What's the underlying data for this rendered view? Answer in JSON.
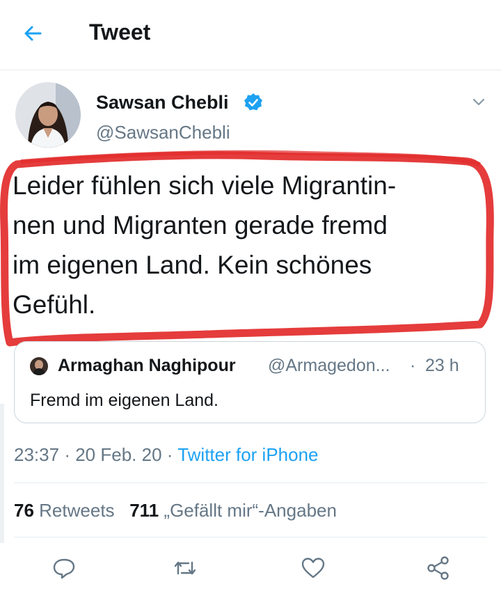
{
  "header": {
    "title": "Tweet",
    "back_icon": "arrow-left-icon",
    "accent_color": "#1da1f2"
  },
  "tweet": {
    "author_name": "Sawsan Chebli",
    "author_handle": "@SawsanChebli",
    "verified": true,
    "text_lines": [
      "Leider fühlen sich viele Migrantin-",
      "nen und Migranten gerade fremd",
      "im eigenen Land. Kein schönes",
      "Gefühl."
    ],
    "highlight_color": "#e32b2b"
  },
  "quoted_tweet": {
    "author_name": "Armaghan Naghipour",
    "author_handle": "@Armagedon...",
    "time": "23 h",
    "separator": "·",
    "text": "Fremd im eigenen Land."
  },
  "meta": {
    "time": "23:37",
    "date": "20 Feb. 20",
    "separator": "·",
    "source": "Twitter for iPhone"
  },
  "stats": {
    "retweets_count": "76",
    "retweets_label": "Retweets",
    "likes_count": "711",
    "likes_label": "„Gefällt mir“-Angaben"
  },
  "actions": [
    {
      "icon": "reply-icon"
    },
    {
      "icon": "retweet-icon"
    },
    {
      "icon": "heart-icon"
    },
    {
      "icon": "share-icon"
    }
  ]
}
